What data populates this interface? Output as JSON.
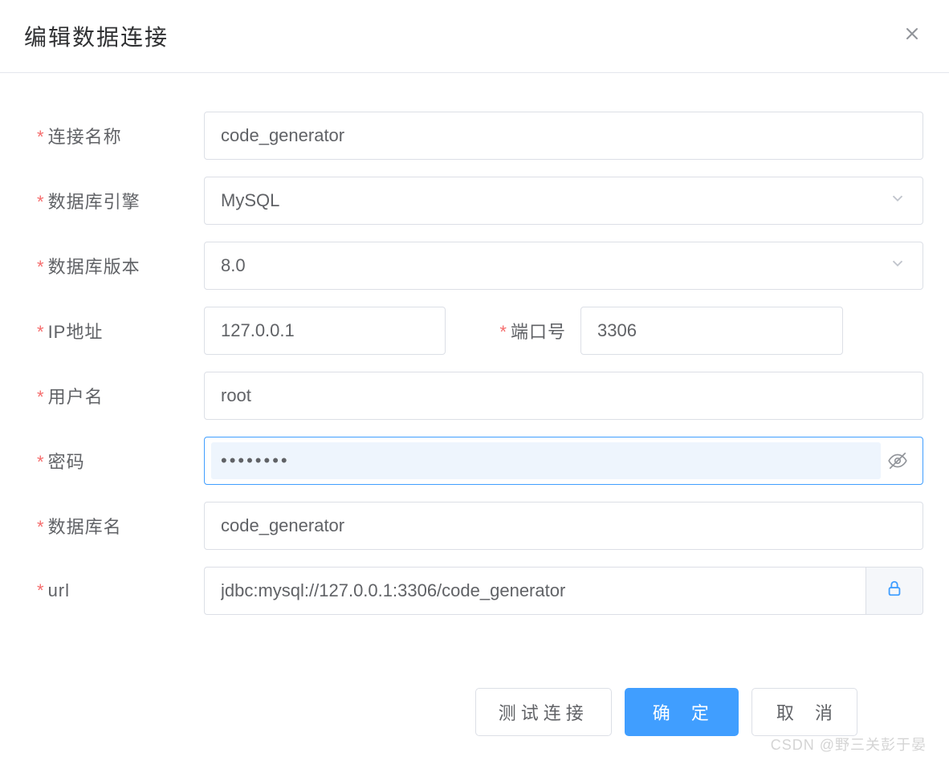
{
  "header": {
    "title": "编辑数据连接"
  },
  "form": {
    "connectionName": {
      "label": "连接名称",
      "value": "code_generator"
    },
    "dbEngine": {
      "label": "数据库引擎",
      "value": "MySQL"
    },
    "dbVersion": {
      "label": "数据库版本",
      "value": "8.0"
    },
    "ip": {
      "label": "IP地址",
      "value": "127.0.0.1"
    },
    "port": {
      "label": "端口号",
      "value": "3306"
    },
    "username": {
      "label": "用户名",
      "value": "root"
    },
    "password": {
      "label": "密码",
      "value": "••••••••"
    },
    "dbName": {
      "label": "数据库名",
      "value": "code_generator"
    },
    "url": {
      "label": "url",
      "value": "jdbc:mysql://127.0.0.1:3306/code_generator"
    }
  },
  "footer": {
    "testConnection": "测试连接",
    "confirm": "确 定",
    "cancel": "取 消"
  },
  "watermark": "CSDN @野三关彭于晏"
}
